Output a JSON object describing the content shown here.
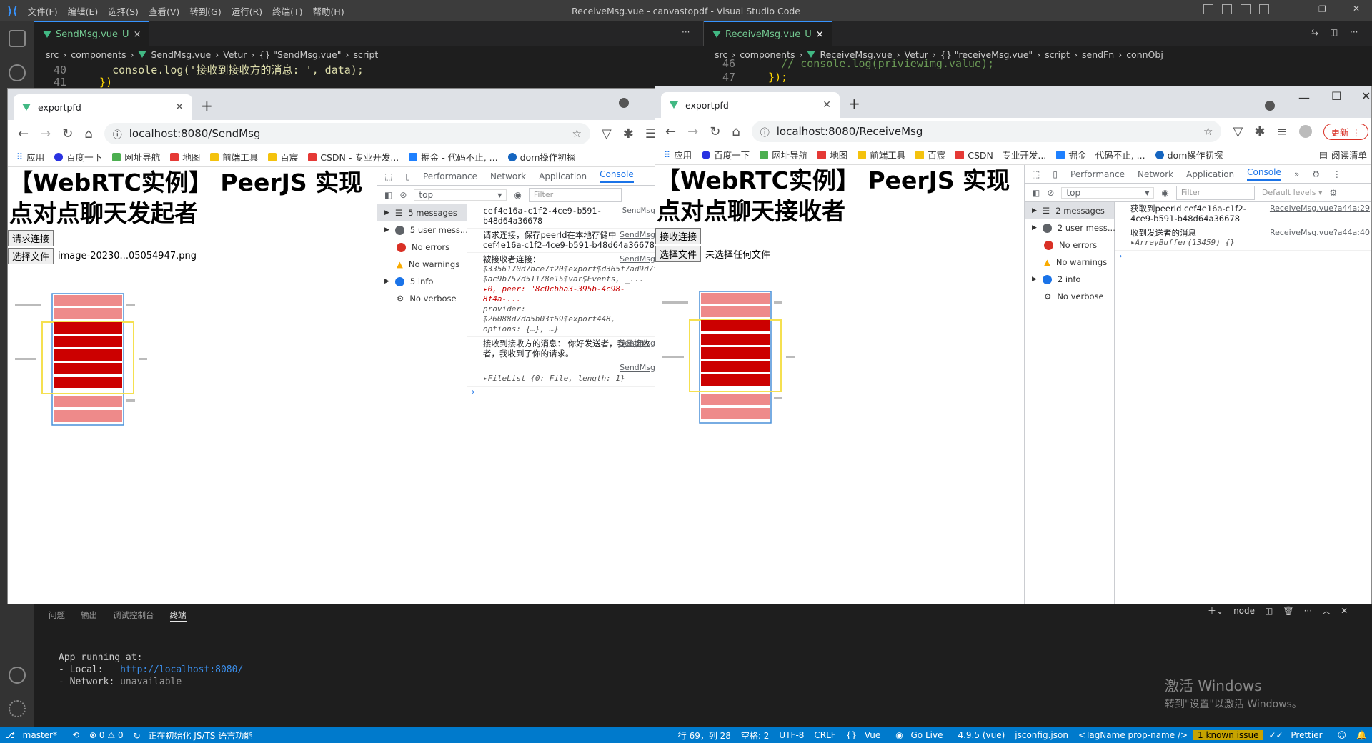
{
  "vscode": {
    "menu": [
      "文件(F)",
      "编辑(E)",
      "选择(S)",
      "查看(V)",
      "转到(G)",
      "运行(R)",
      "终端(T)",
      "帮助(H)"
    ],
    "window_title": "ReceiveMsg.vue - canvastopdf - Visual Studio Code",
    "left_editor": {
      "tab_label": "SendMsg.vue",
      "tab_status": "U",
      "breadcrumb": [
        "src",
        "components",
        "SendMsg.vue",
        "Vetur",
        "{} \"SendMsg.vue\"",
        "script"
      ],
      "lines": [
        {
          "num": "40",
          "code": "    console.log('接收到接收方的消息: ', data);"
        },
        {
          "num": "41",
          "code": "  })"
        }
      ]
    },
    "right_editor": {
      "tab_label": "ReceiveMsg.vue",
      "tab_status": "U",
      "breadcrumb": [
        "src",
        "components",
        "ReceiveMsg.vue",
        "Vetur",
        "{} \"receiveMsg.vue\"",
        "script",
        "sendFn",
        "connObj"
      ],
      "lines": [
        {
          "num": "46",
          "code": "    // console.log(priviewimg.value);"
        },
        {
          "num": "47",
          "code": "  });"
        }
      ]
    },
    "panel_tabs": [
      "问题",
      "输出",
      "调试控制台",
      "终端"
    ],
    "panel_active": "终端",
    "panel_shell": "node",
    "terminal": {
      "line1": "App running at:",
      "local_label": "- Local:   ",
      "local_url": "http://localhost:8080/",
      "network_label": "- Network: ",
      "network_value": "unavailable"
    },
    "watermark": {
      "title": "激活 Windows",
      "sub": "转到\"设置\"以激活 Windows。"
    },
    "status": {
      "branch": "master*",
      "errors": "⊗ 0 ⚠ 0",
      "init": "正在初始化 JS/TS 语言功能",
      "position": "行 69，列 28",
      "spaces": "空格: 2",
      "encoding": "UTF-8",
      "eol": "CRLF",
      "lang": "Vue",
      "golive": "Go Live",
      "version": "4.9.5 (vue)",
      "tsconfig": "jsconfig.json",
      "tagname": "<TagName prop-name />",
      "issue": "1 known issue",
      "prettier": "Prettier"
    }
  },
  "send_window": {
    "tab_title": "exportpfd",
    "url": "localhost:8080/SendMsg",
    "bookmarks": [
      "应用",
      "百度一下",
      "网址导航",
      "地图",
      "前端工具",
      "百宸",
      "CSDN - 专业开发...",
      "掘金 - 代码不止, ...",
      "dom操作初探"
    ],
    "heading": "【WebRTC实例】 PeerJS 实现点对点聊天发起者",
    "connect_button": "请求连接",
    "file_button": "选择文件",
    "file_name": "image-20230...05054947.png",
    "devtools_tabs": [
      "Performance",
      "Network",
      "Application",
      "Console"
    ],
    "context": "top",
    "filter_placeholder": "Filter",
    "sidebar": [
      {
        "label": "5 messages",
        "icon": "list"
      },
      {
        "label": "5 user mess...",
        "icon": "user"
      },
      {
        "label": "No errors",
        "icon": "error"
      },
      {
        "label": "No warnings",
        "icon": "warning"
      },
      {
        "label": "5 info",
        "icon": "info"
      },
      {
        "label": "No verbose",
        "icon": "verbose"
      }
    ],
    "console": [
      {
        "text": "cef4e16a-c1f2-4ce9-b591-b48d64a36678",
        "src": "SendMsg"
      },
      {
        "text": "请求连接，保存peerId在本地存储中 cef4e16a-c1f2-4ce9-b591-b48d64a36678",
        "src": "SendMsg"
      },
      {
        "text": "被接收者连接：",
        "detail": "$3356170d7bce7f20$export$d365f7ad9d7ts: $ac9b757d51178e15$var$Events, _...",
        "detail2": "▸0, peer: \"8c0cbba3-395b-4c98-8f4a-...",
        "detail3": "provider: $26088d7da5b03f69$export448, options: {…}, …}",
        "src": "SendMsg"
      },
      {
        "text": "接收到接收方的消息： 你好发送者，我是接收者，我收到了你的请求。",
        "src": "SendMsg"
      },
      {
        "text": "▸FileList {0: File, length: 1}",
        "src": "SendMsg"
      }
    ]
  },
  "receive_window": {
    "tab_title": "exportpfd",
    "url": "localhost:8080/ReceiveMsg",
    "bookmarks": [
      "应用",
      "百度一下",
      "网址导航",
      "地图",
      "前端工具",
      "百宸",
      "CSDN - 专业开发...",
      "掘金 - 代码不止, ...",
      "dom操作初探",
      "阅读清单"
    ],
    "update_label": "更新",
    "heading": "【WebRTC实例】 PeerJS 实现点对点聊天接收者",
    "connect_button": "接收连接",
    "file_button": "选择文件",
    "file_name": "未选择任何文件",
    "devtools_tabs": [
      "Performance",
      "Network",
      "Application",
      "Console"
    ],
    "context": "top",
    "filter_placeholder": "Filter",
    "levels": "Default levels ▾",
    "sidebar": [
      {
        "label": "2 messages",
        "icon": "list"
      },
      {
        "label": "2 user mess...",
        "icon": "user"
      },
      {
        "label": "No errors",
        "icon": "error"
      },
      {
        "label": "No warnings",
        "icon": "warning"
      },
      {
        "label": "2 info",
        "icon": "info"
      },
      {
        "label": "No verbose",
        "icon": "verbose"
      }
    ],
    "console": [
      {
        "text": "获取到peerId cef4e16a-c1f2-4ce9-b591-b48d64a36678",
        "src": "ReceiveMsg.vue?a44a:29"
      },
      {
        "text": "收到发送者的消息",
        "detail": "▸ArrayBuffer(13459) {}",
        "src": "ReceiveMsg.vue?a44a:40"
      }
    ]
  },
  "colors": {
    "bar_dark": "#cc0000",
    "bar_light": "#ee8a8a",
    "frame": "#4a90d9",
    "highlight": "#f5e050"
  }
}
